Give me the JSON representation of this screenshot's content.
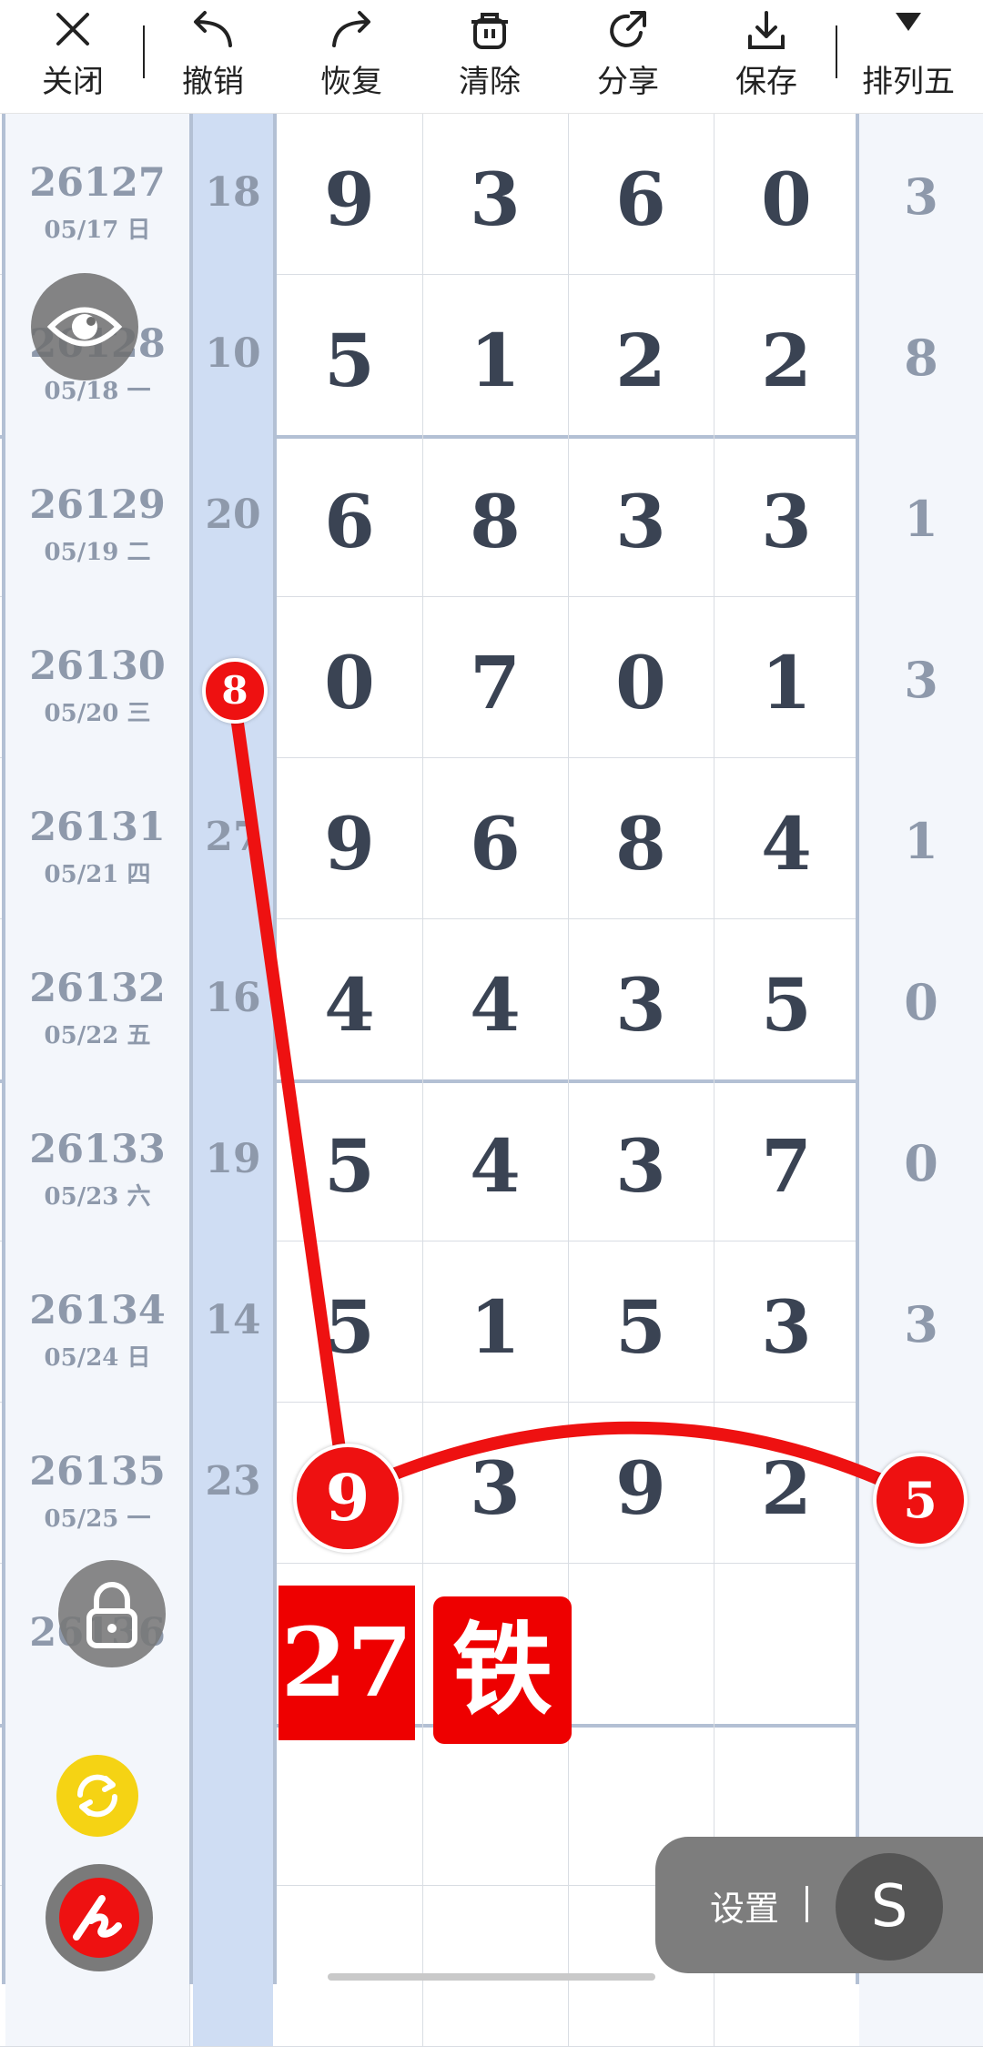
{
  "toolbar": {
    "close_label": "关闭",
    "undo_label": "撤销",
    "redo_label": "恢复",
    "clear_label": "清除",
    "share_label": "分享",
    "save_label": "保存",
    "lottery_label": "排列五"
  },
  "rows": [
    {
      "issue": "26127",
      "date": "05/17 日",
      "sum": "18",
      "d1": "9",
      "d2": "3",
      "d3": "6",
      "d4": "0",
      "d5": "3"
    },
    {
      "issue": "26128",
      "date": "05/18 一",
      "sum": "10",
      "d1": "5",
      "d2": "1",
      "d3": "2",
      "d4": "2",
      "d5": "8"
    },
    {
      "issue": "26129",
      "date": "05/19 二",
      "sum": "20",
      "d1": "6",
      "d2": "8",
      "d3": "3",
      "d4": "3",
      "d5": "1"
    },
    {
      "issue": "26130",
      "date": "05/20 三",
      "sum": "",
      "d1": "0",
      "d2": "7",
      "d3": "0",
      "d4": "1",
      "d5": "3"
    },
    {
      "issue": "26131",
      "date": "05/21 四",
      "sum": "27",
      "d1": "9",
      "d2": "6",
      "d3": "8",
      "d4": "4",
      "d5": "1"
    },
    {
      "issue": "26132",
      "date": "05/22 五",
      "sum": "16",
      "d1": "4",
      "d2": "4",
      "d3": "3",
      "d4": "5",
      "d5": "0"
    },
    {
      "issue": "26133",
      "date": "05/23 六",
      "sum": "19",
      "d1": "5",
      "d2": "4",
      "d3": "3",
      "d4": "7",
      "d5": "0"
    },
    {
      "issue": "26134",
      "date": "05/24 日",
      "sum": "14",
      "d1": "5",
      "d2": "1",
      "d3": "5",
      "d4": "3",
      "d5": "3"
    },
    {
      "issue": "26135",
      "date": "05/25 一",
      "sum": "23",
      "d1": "",
      "d2": "3",
      "d3": "9",
      "d4": "2",
      "d5": ""
    },
    {
      "issue": "26136",
      "date": "",
      "sum": "",
      "d1": "",
      "d2": "",
      "d3": "",
      "d4": "",
      "d5": ""
    },
    {
      "issue": "",
      "date": "",
      "sum": "",
      "d1": "",
      "d2": "",
      "d3": "",
      "d4": "",
      "d5": ""
    },
    {
      "issue": "",
      "date": "",
      "sum": "",
      "d1": "",
      "d2": "",
      "d3": "",
      "d4": "",
      "d5": ""
    }
  ],
  "markings": {
    "ball_top": "8",
    "ball_mid": "9",
    "ball_right": "5",
    "badge_number": "27",
    "badge_text": "铁",
    "line_color": "#ee1111"
  },
  "controls": {
    "settings_label": "设置",
    "settings_icon_letter": "S",
    "eye_icon": "eye-icon",
    "lock_icon": "lock-icon",
    "refresh_icon": "refresh-icon",
    "pen_icon": "pen-icon"
  }
}
